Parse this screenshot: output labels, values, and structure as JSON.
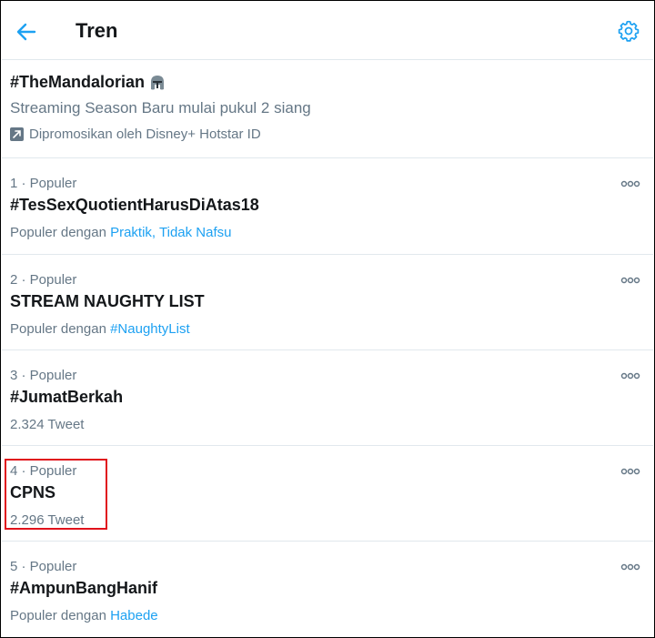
{
  "header": {
    "title": "Tren",
    "back_icon": "arrow-left-icon",
    "settings_icon": "gear-icon"
  },
  "promoted": {
    "hashtag": "#TheMandalorian",
    "hashtag_icon": "mandalorian-helmet-icon",
    "description": "Streaming Season Baru mulai pukul 2 siang",
    "promoted_by": "Dipromosikan oleh Disney+ Hotstar ID",
    "promoted_icon": "promoted-arrow-icon"
  },
  "trends": [
    {
      "meta": "1 · Populer",
      "name": "#TesSexQuotientHarusDiAtas18",
      "sub_prefix": "Populer dengan ",
      "sub_links": "Praktik, Tidak Nafsu"
    },
    {
      "meta": "2 · Populer",
      "name": "STREAM NAUGHTY LIST",
      "sub_prefix": "Populer dengan ",
      "sub_links": "#NaughtyList"
    },
    {
      "meta": "3 · Populer",
      "name": "#JumatBerkah",
      "sub_text": "2.324 Tweet"
    },
    {
      "meta": "4 · Populer",
      "name": "CPNS",
      "sub_text": "2.296 Tweet"
    },
    {
      "meta": "5 · Populer",
      "name": "#AmpunBangHanif",
      "sub_prefix": "Populer dengan ",
      "sub_links": "Habede"
    }
  ],
  "colors": {
    "accent": "#1da1f2",
    "secondary_text": "#657786",
    "highlight": "#e0121b"
  }
}
